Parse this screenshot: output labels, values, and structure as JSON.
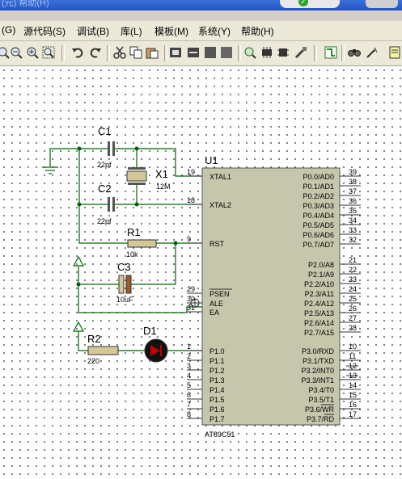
{
  "window": {
    "title_fragment": "(元)  帮助(H)"
  },
  "menu": {
    "items": [
      "(G)",
      "源代码(S)",
      "调试(B)",
      "库(L)",
      "模板(M)",
      "系统(Y)",
      "帮助(H)"
    ]
  },
  "toolbar": {
    "icons": [
      "zoom-in-icon",
      "zoom-out-icon",
      "zoom-area-icon",
      "zoom-all-icon",
      "undo-icon",
      "redo-icon",
      "cut-icon",
      "copy-icon",
      "paste-icon",
      "block-copy-icon",
      "block-move-icon",
      "block-rotate-icon",
      "block-delete-icon",
      "pick-device-icon",
      "make-device-icon",
      "packaging-icon",
      "decompose-icon",
      "wire-autorouter-icon",
      "search-tag-icon",
      "property-assignment-icon",
      "new-sheet-icon"
    ]
  },
  "schematic": {
    "u1": {
      "ref": "U1",
      "part": "AT89C51",
      "left_pins": [
        {
          "num": "19",
          "name": "XTAL1"
        },
        {
          "num": "18",
          "name": "XTAL2"
        },
        {
          "num": "9",
          "name": "RST"
        },
        {
          "num": "29",
          "name": "PSEN"
        },
        {
          "num": "30",
          "name": "ALE"
        },
        {
          "num": "31",
          "name": "EA"
        },
        {
          "num": "1",
          "name": "P1.0"
        },
        {
          "num": "2",
          "name": "P1.1"
        },
        {
          "num": "3",
          "name": "P1.2"
        },
        {
          "num": "4",
          "name": "P1.3"
        },
        {
          "num": "5",
          "name": "P1.4"
        },
        {
          "num": "6",
          "name": "P1.5"
        },
        {
          "num": "7",
          "name": "P1.6"
        },
        {
          "num": "8",
          "name": "P1.7"
        }
      ],
      "right_pins": [
        {
          "num": "39",
          "name": "P0.0/AD0"
        },
        {
          "num": "38",
          "name": "P0.1/AD1"
        },
        {
          "num": "37",
          "name": "P0.2/AD2"
        },
        {
          "num": "36",
          "name": "P0.3/AD3"
        },
        {
          "num": "35",
          "name": "P0.4/AD4"
        },
        {
          "num": "34",
          "name": "P0.5/AD5"
        },
        {
          "num": "33",
          "name": "P0.6/AD6"
        },
        {
          "num": "32",
          "name": "P0.7/AD7"
        },
        {
          "num": "21",
          "name": "P2.0/A8"
        },
        {
          "num": "22",
          "name": "P2.1/A9"
        },
        {
          "num": "23",
          "name": "P2.2/A10"
        },
        {
          "num": "24",
          "name": "P2.3/A11"
        },
        {
          "num": "25",
          "name": "P2.4/A12"
        },
        {
          "num": "26",
          "name": "P2.5/A13"
        },
        {
          "num": "27",
          "name": "P2.6/A14"
        },
        {
          "num": "28",
          "name": "P2.7/A15"
        },
        {
          "num": "10",
          "name": "P3.0/RXD"
        },
        {
          "num": "11",
          "name": "P3.1/TXD"
        },
        {
          "num": "12",
          "name": "P3.2/INT0"
        },
        {
          "num": "13",
          "name": "P3.3/INT1"
        },
        {
          "num": "14",
          "name": "P3.4/T0"
        },
        {
          "num": "15",
          "name": "P3.5/T1"
        },
        {
          "num": "16",
          "name": "P3.6/WR"
        },
        {
          "num": "17",
          "name": "P3.7/RD"
        }
      ]
    },
    "c1": {
      "ref": "C1",
      "value": "22pf"
    },
    "c2": {
      "ref": "C2",
      "value": "22pf"
    },
    "c3": {
      "ref": "C3",
      "value": "10uF"
    },
    "x1": {
      "ref": "X1",
      "value": "12M"
    },
    "r1": {
      "ref": "R1",
      "value": "10k"
    },
    "r2": {
      "ref": "R2",
      "value": "220"
    },
    "d1": {
      "ref": "D1"
    }
  }
}
